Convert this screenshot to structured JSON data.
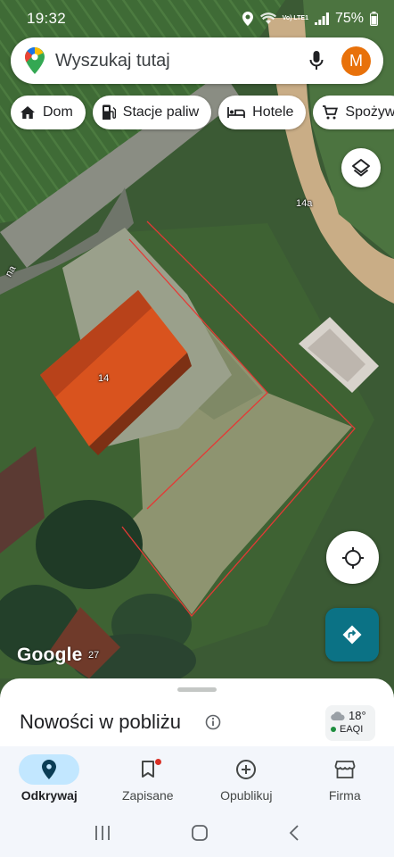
{
  "status_bar": {
    "time": "19:32",
    "network": "Vo) LTE1",
    "battery": "75%"
  },
  "search": {
    "placeholder": "Wyszukaj tutaj",
    "avatar_letter": "M"
  },
  "chips": [
    {
      "label": "Dom",
      "icon": "home-icon"
    },
    {
      "label": "Stacje paliw",
      "icon": "gas-station-icon"
    },
    {
      "label": "Hotele",
      "icon": "bed-icon"
    },
    {
      "label": "Spożyw",
      "icon": "cart-icon"
    }
  ],
  "map": {
    "labels": {
      "house_14": "14",
      "house_14a": "14a",
      "house_27": "27",
      "street_fragment": "na"
    },
    "attribution": "Google",
    "outline_color": "#e53935"
  },
  "sheet": {
    "title": "Nowości w pobliżu",
    "weather": {
      "temperature": "18°",
      "aqi_label": "EAQI"
    }
  },
  "bottom_nav": [
    {
      "label": "Odkrywaj",
      "icon": "explore-pin-icon",
      "active": true
    },
    {
      "label": "Zapisane",
      "icon": "bookmark-icon",
      "active": false
    },
    {
      "label": "Opublikuj",
      "icon": "add-circle-icon",
      "active": false
    },
    {
      "label": "Firma",
      "icon": "storefront-icon",
      "active": false
    }
  ],
  "colors": {
    "accent": "#0b7285",
    "active_nav_bg": "#c2e7ff",
    "avatar_bg": "#e8710a"
  }
}
